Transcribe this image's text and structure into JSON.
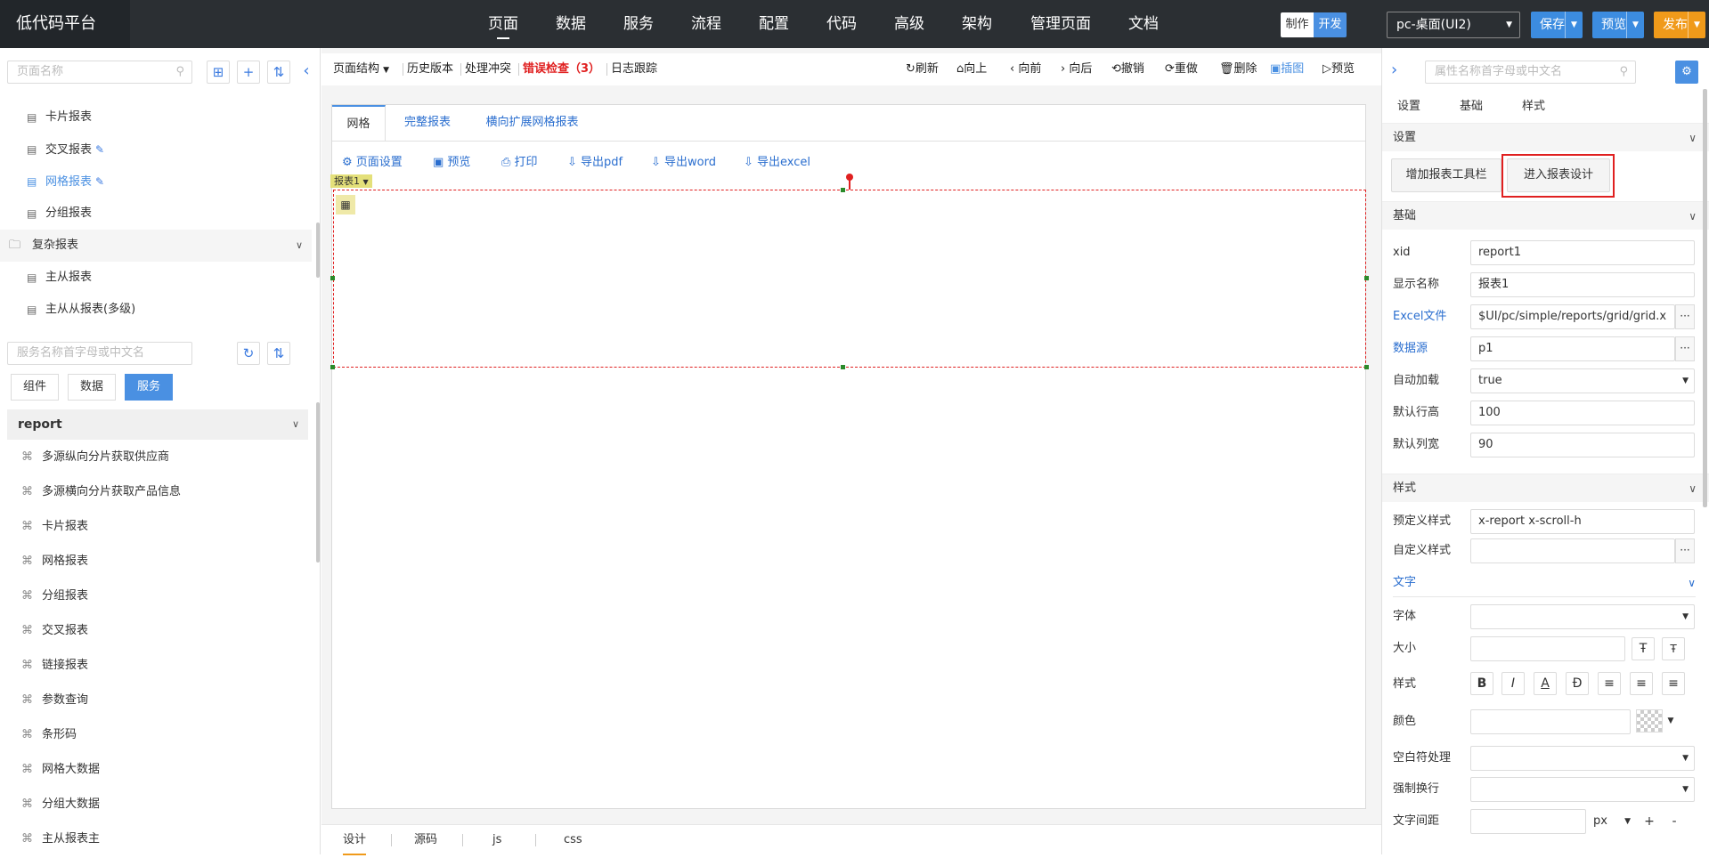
{
  "app_title": "低代码平台",
  "nav": {
    "items": [
      "页面",
      "数据",
      "服务",
      "流程",
      "配置",
      "代码",
      "高级",
      "架构",
      "管理页面",
      "文档"
    ],
    "active_index": 0
  },
  "mode_toggle": {
    "make_label": "制作",
    "dev_label": "开发",
    "active": "开发"
  },
  "platform_select": {
    "value": "pc-桌面(UI2)"
  },
  "top_actions": {
    "save_label": "保存",
    "preview_label": "预览",
    "publish_label": "发布"
  },
  "left": {
    "page_search_placeholder": "页面名称",
    "page_tree": [
      {
        "label": "卡片报表",
        "editable": false,
        "active": false
      },
      {
        "label": "交叉报表",
        "editable": true,
        "active": false
      },
      {
        "label": "网格报表",
        "editable": true,
        "active": true
      },
      {
        "label": "分组报表",
        "editable": false,
        "active": false
      }
    ],
    "group_label": "复杂报表",
    "group_children": [
      "主从报表",
      "主从从报表(多级)"
    ],
    "service_search_placeholder": "服务名称首字母或中文名",
    "tabs": [
      "组件",
      "数据",
      "服务"
    ],
    "active_tab": "服务",
    "service_group": "report",
    "services": [
      "多源纵向分片获取供应商",
      "多源横向分片获取产品信息",
      "卡片报表",
      "网格报表",
      "分组报表",
      "交叉报表",
      "链接报表",
      "参数查询",
      "条形码",
      "网格大数据",
      "分组大数据",
      "主从报表主"
    ]
  },
  "toolbar": {
    "page_structure": "页面结构",
    "history": "历史版本",
    "conflicts": "处理冲突",
    "error_check": "错误检查（3）",
    "log_trace": "日志跟踪",
    "refresh": "刷新",
    "up": "向上",
    "forward": "向前",
    "backward": "向后",
    "undo": "撤销",
    "redo": "重做",
    "delete": "删除",
    "insert_image": "插图",
    "preview": "预览"
  },
  "canvas": {
    "tabs": [
      "网格",
      "完整报表",
      "横向扩展网格报表"
    ],
    "active_tab": "网格",
    "report_toolbar": [
      "页面设置",
      "预览",
      "打印",
      "导出pdf",
      "导出word",
      "导出excel"
    ],
    "report_tag": "报表1"
  },
  "bottom_tabs": [
    "设计",
    "源码",
    "js",
    "css"
  ],
  "bottom_active": "设计",
  "right": {
    "search_placeholder": "属性名称首字母或中文名",
    "tabs": [
      "设置",
      "基础",
      "样式"
    ],
    "settings_section": "设置",
    "add_toolbar_btn": "增加报表工具栏",
    "enter_design_btn": "进入报表设计",
    "basic_section": "基础",
    "fields": [
      {
        "label": "xid",
        "value": "report1",
        "blue": false,
        "more": false,
        "dropdown": false
      },
      {
        "label": "显示名称",
        "value": "报表1",
        "blue": false,
        "more": false,
        "dropdown": false
      },
      {
        "label": "Excel文件",
        "value": "$UI/pc/simple/reports/grid/grid.x",
        "blue": true,
        "more": true,
        "dropdown": false
      },
      {
        "label": "数据源",
        "value": "p1",
        "blue": true,
        "more": true,
        "dropdown": false
      },
      {
        "label": "自动加载",
        "value": "true",
        "blue": false,
        "more": false,
        "dropdown": true
      },
      {
        "label": "默认行高",
        "value": "100",
        "blue": false,
        "more": false,
        "dropdown": false
      },
      {
        "label": "默认列宽",
        "value": "90",
        "blue": false,
        "more": false,
        "dropdown": false
      }
    ],
    "style_section": "样式",
    "predefined_style_label": "预定义样式",
    "predefined_style_value": "x-report x-scroll-h",
    "custom_style_label": "自定义样式",
    "text_section": "文字",
    "font_label": "字体",
    "size_label": "大小",
    "style_label": "样式",
    "color_label": "颜色",
    "whitespace_label": "空白符处理",
    "wrap_label": "强制换行",
    "letter_spacing_label": "文字间距",
    "unit_value": "px"
  },
  "colors": {
    "accent": "#4a90e2",
    "save_btn": "#3c8ce0",
    "publish_btn": "#f09a1a",
    "error": "#e02020",
    "topbar": "#2b2f33"
  }
}
